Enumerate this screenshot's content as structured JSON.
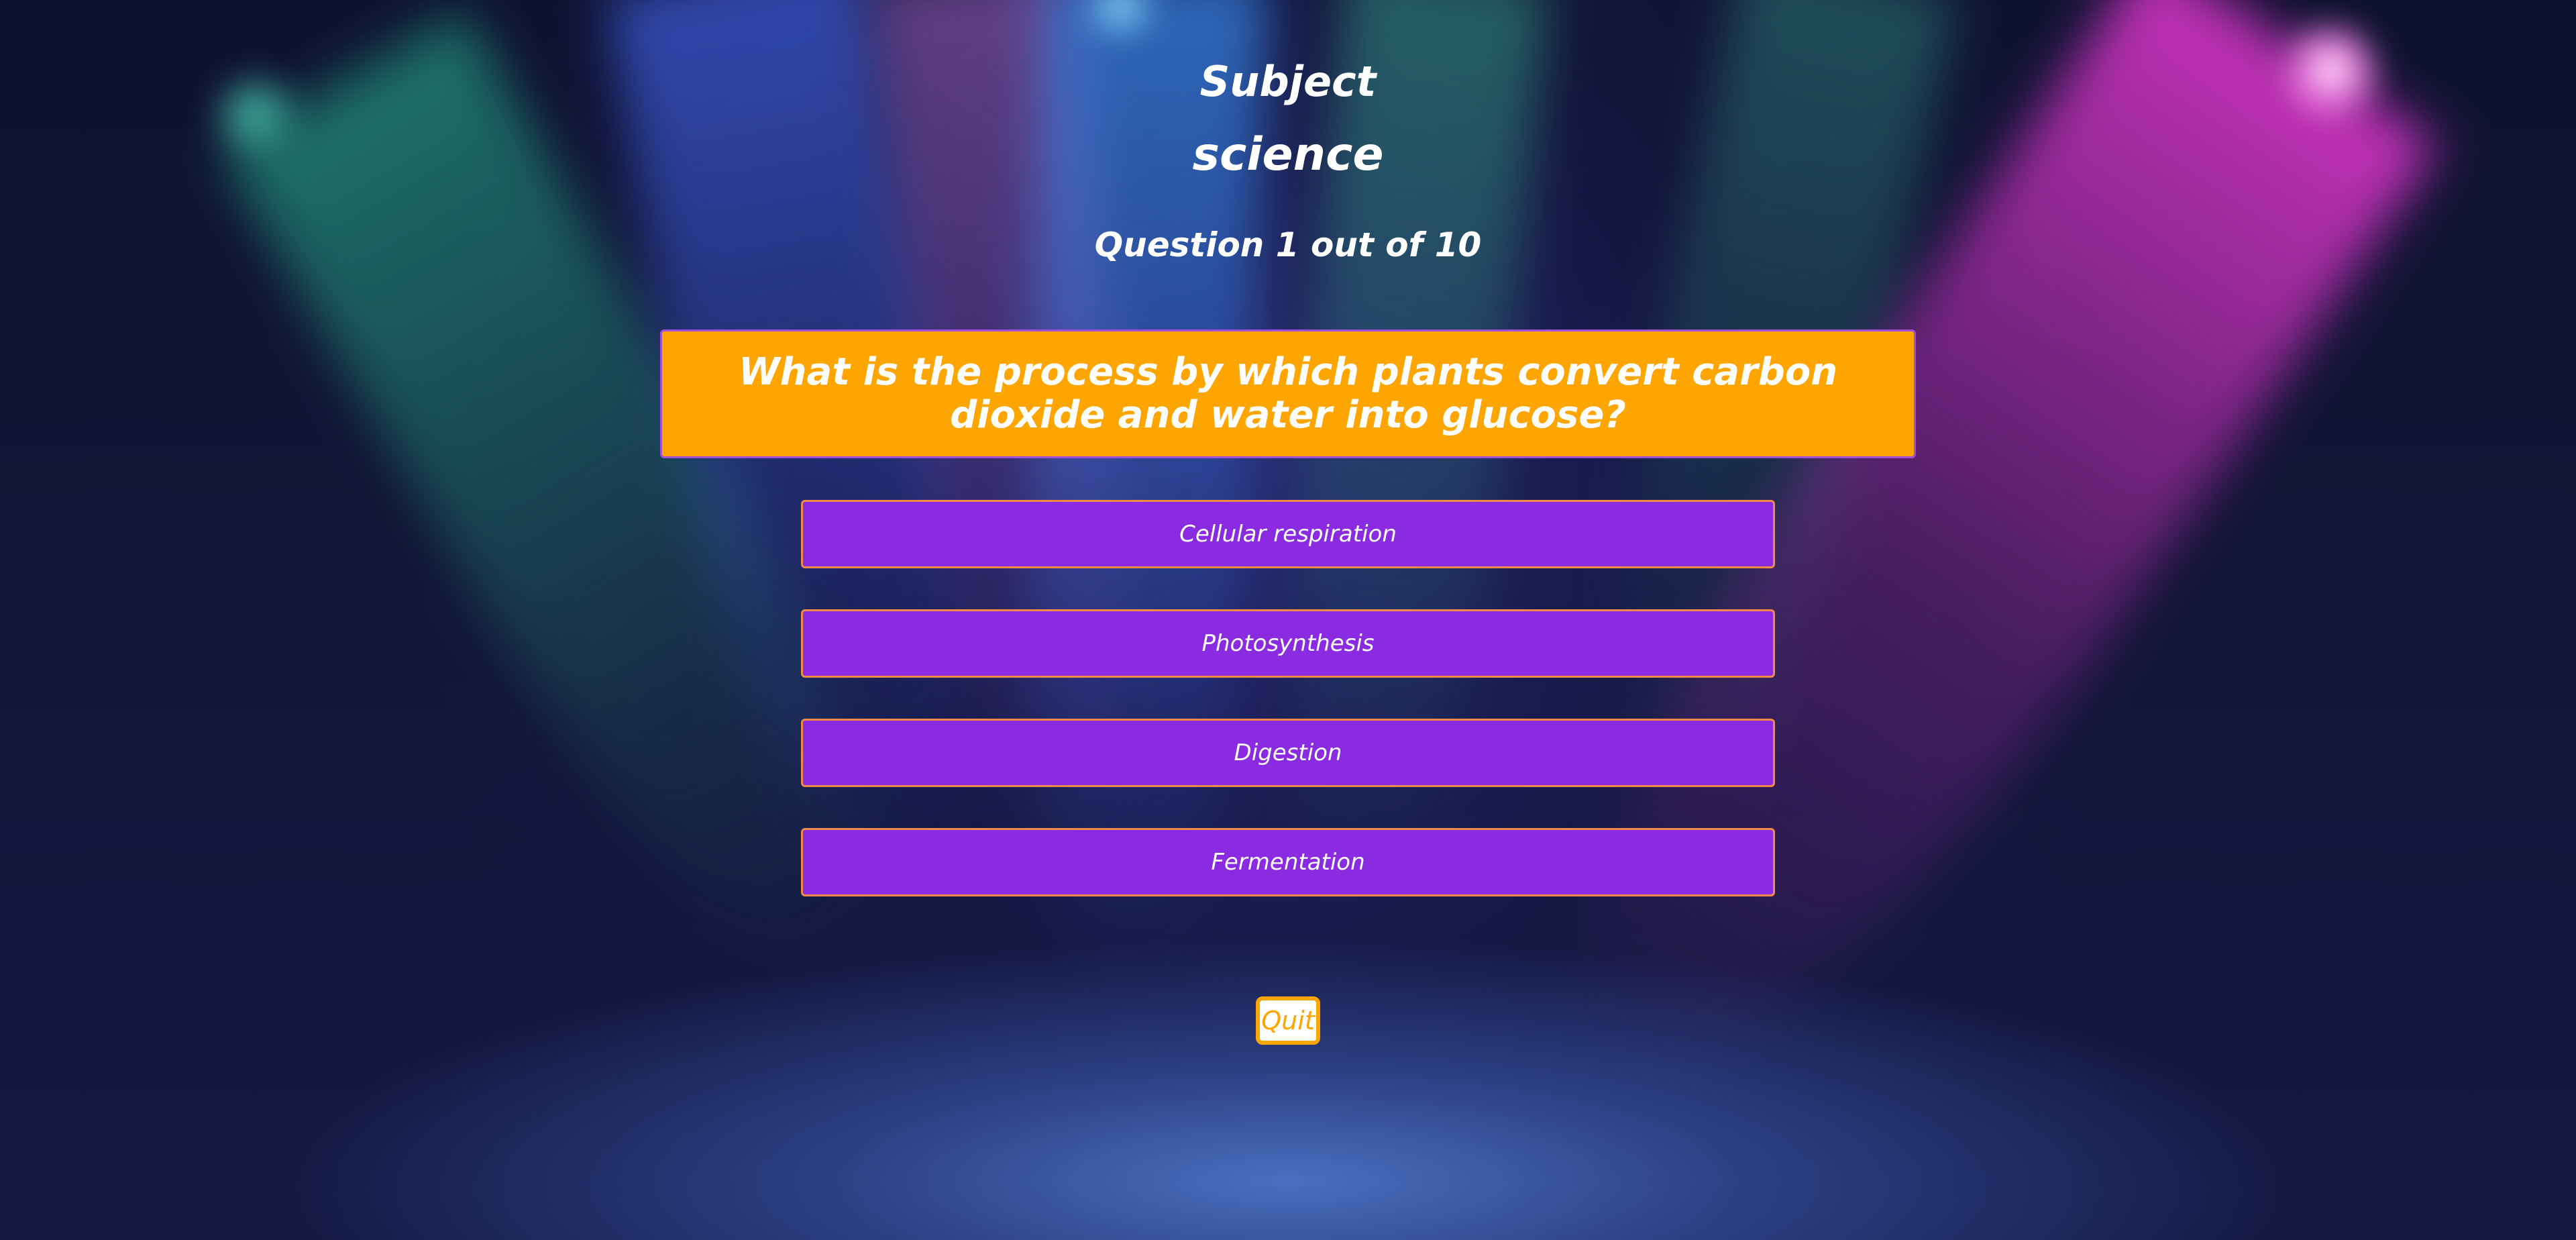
{
  "header": {
    "title": "Subject",
    "subject": "science",
    "counter": "Question 1 out of 10"
  },
  "question": {
    "text": "What is the process by which plants convert carbon dioxide and water into glucose?"
  },
  "answers": [
    {
      "label": "Cellular respiration"
    },
    {
      "label": "Photosynthesis"
    },
    {
      "label": "Digestion"
    },
    {
      "label": "Fermentation"
    }
  ],
  "controls": {
    "quit_label": "Quit"
  },
  "colors": {
    "question_background": "#ffa500",
    "answer_background": "#8a2be2",
    "answer_border": "#f08a4b",
    "quit_accent": "#ffa500"
  }
}
